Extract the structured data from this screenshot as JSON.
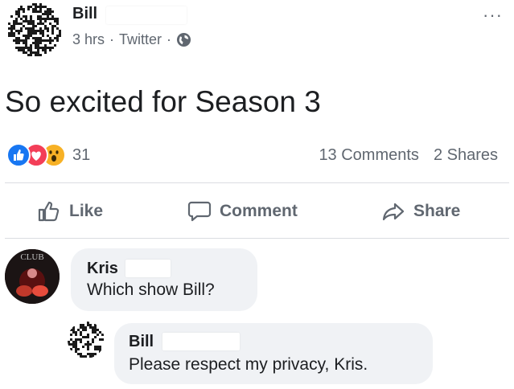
{
  "post": {
    "author": "Bill",
    "time": "3 hrs",
    "source": "Twitter",
    "separator": "·",
    "privacy_icon": "globe-icon",
    "menu": "···",
    "text": "So excited for Season 3"
  },
  "reactions": {
    "icons": [
      "like-reaction-icon",
      "love-reaction-icon",
      "wow-reaction-icon"
    ],
    "count": "31",
    "comments": "13 Comments",
    "shares": "2 Shares"
  },
  "actions": {
    "like": "Like",
    "comment": "Comment",
    "share": "Share"
  },
  "comments": [
    {
      "author": "Kris",
      "text": "Which show Bill?"
    },
    {
      "author": "Bill",
      "text": "Please respect my privacy, Kris."
    }
  ],
  "colors": {
    "text": "#1c1e21",
    "muted": "#606770",
    "bubble": "#f0f2f5",
    "like_blue": "#1877f2",
    "love_red": "#f33e58",
    "wow_yellow": "#f7b125"
  }
}
